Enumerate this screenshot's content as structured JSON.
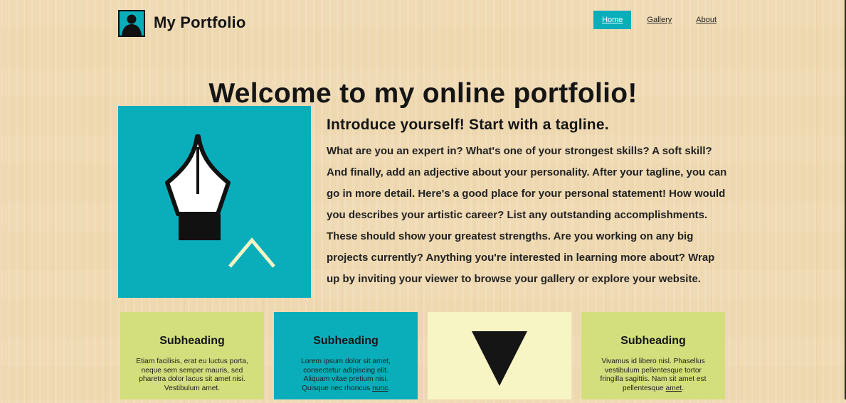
{
  "site": {
    "title": "My Portfolio",
    "welcome": "Welcome to my online portfolio!"
  },
  "nav": {
    "home": "Home",
    "gallery": "Gallery",
    "about": "About",
    "active": "Home"
  },
  "intro": {
    "tagline": "Introduce yourself! Start with a tagline.",
    "lines": [
      "What are you an expert in? What's one of your strongest skills? A soft skill?",
      "And finally, add an adjective about your personality. After your tagline, you can",
      "go in more detail. Here's a good place for your personal statement! How would",
      "you describes your artistic career? List any outstanding accomplishments.",
      "These should show your greatest strengths. Are you working on any big",
      "projects currently? Anything you're interested in learning more about? Wrap",
      "up by inviting your viewer to browse your gallery or explore your website."
    ]
  },
  "cards": [
    {
      "heading": "Subheading",
      "lines": [
        "Etiam facilisis, erat eu luctus porta,",
        "neque sem semper mauris, sed",
        "pharetra dolor lacus sit amet nisi.",
        "Vestibulum amet."
      ],
      "link": ""
    },
    {
      "heading": "Subheading",
      "lines": [
        "Lorem ipsum dolor sit amet,",
        "consectetur adipiscing elit.",
        "Aliquam vitae pretium nisi."
      ],
      "last_prefix": "Quisque nec rhoncus ",
      "link": "nunc",
      "last_suffix": "."
    },
    {
      "icon": "down-triangle-icon"
    },
    {
      "heading": "Subheading",
      "lines": [
        "Vivamus id libero nisl. Phasellus",
        "vestibulum pellentesque tortor",
        "fringilla sagittis. Nam sit amet est"
      ],
      "last_prefix": "pellentesque ",
      "link": "amet",
      "last_suffix": "."
    }
  ],
  "colors": {
    "accent": "#0aaebb",
    "lime": "#d3de7d",
    "cream": "#f8f5c5",
    "chevron": "#f8f5c5",
    "text": "#151515"
  }
}
